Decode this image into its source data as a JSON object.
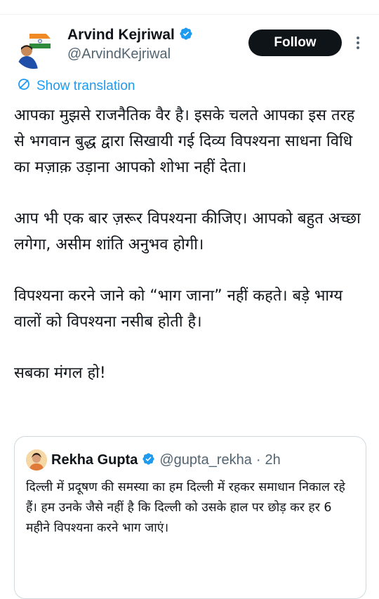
{
  "tweet": {
    "author": {
      "display_name": "Arvind Kejriwal",
      "handle": "@ArvindKejriwal",
      "verified": true
    },
    "follow_label": "Follow",
    "show_translation_label": "Show translation",
    "paragraphs": [
      "आपका मुझसे राजनैतिक वैर है। इसके चलते आपका इस तरह से भगवान बुद्ध द्वारा सिखायी गई दिव्य विपश्यना साधना विधि का मज़ाक़ उड़ाना आपको शोभा नहीं देता।",
      "आप भी एक बार ज़रूर विपश्यना कीजिए। आपको बहुत अच्छा लगेगा, असीम शांति अनुभव होगी।",
      "विपश्यना करने जाने को “भाग जाना” नहीं कहते। बड़े भाग्य वालों को विपश्यना नसीब होती है।",
      "सबका मंगल हो!"
    ]
  },
  "quoted_tweet": {
    "display_name": "Rekha Gupta",
    "handle": "@gupta_rekha",
    "separator": "·",
    "time": "2h",
    "verified": true,
    "text": "दिल्ली में प्रदूषण की समस्या का हम दिल्ली में रहकर समाधान निकाल रहे हैं। हम उनके जैसे नहीं है कि दिल्ली को उसके हाल पर छोड़ कर हर 6 महीने विपश्यना करने भाग जाएं।"
  },
  "colors": {
    "accent": "#1d9bf0",
    "text_primary": "#0f1419",
    "text_secondary": "#536471",
    "border": "#cfd9de"
  },
  "icons": {
    "verified": "verified-badge-icon",
    "translate": "translate-icon",
    "more": "more-vertical-icon"
  }
}
